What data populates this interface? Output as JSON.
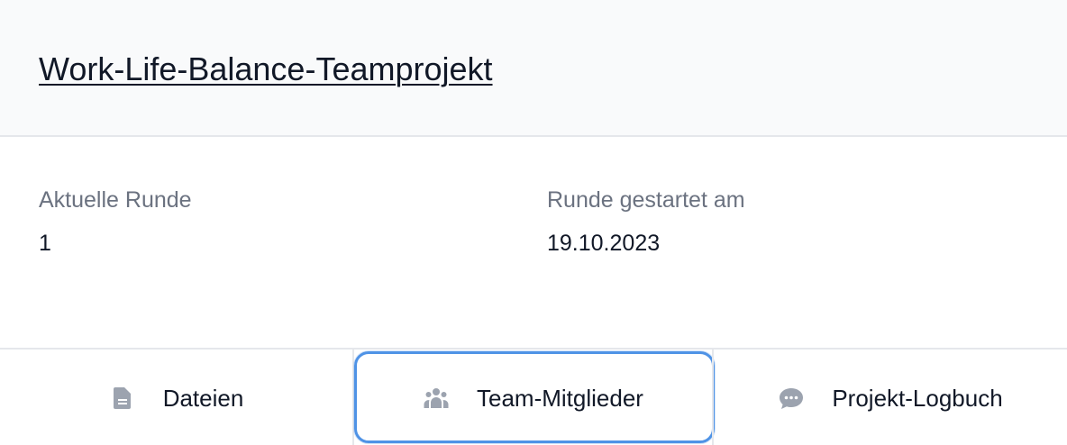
{
  "project": {
    "title": "Work-Life-Balance-Teamprojekt"
  },
  "details": {
    "current_round_label": "Aktuelle Runde",
    "current_round_value": "1",
    "round_started_label": "Runde gestartet am",
    "round_started_value": "19.10.2023"
  },
  "footer": {
    "buttons": [
      {
        "label": "Dateien",
        "icon": "document-icon"
      },
      {
        "label": "Team-Mitglieder",
        "icon": "users-icon",
        "focused": true
      },
      {
        "label": "Projekt-Logbuch",
        "icon": "chat-bubble-icon"
      }
    ]
  },
  "colors": {
    "focus_ring": "#4f93e6",
    "icon_gray": "#9ca3af",
    "header_bg": "#f9fafb"
  }
}
